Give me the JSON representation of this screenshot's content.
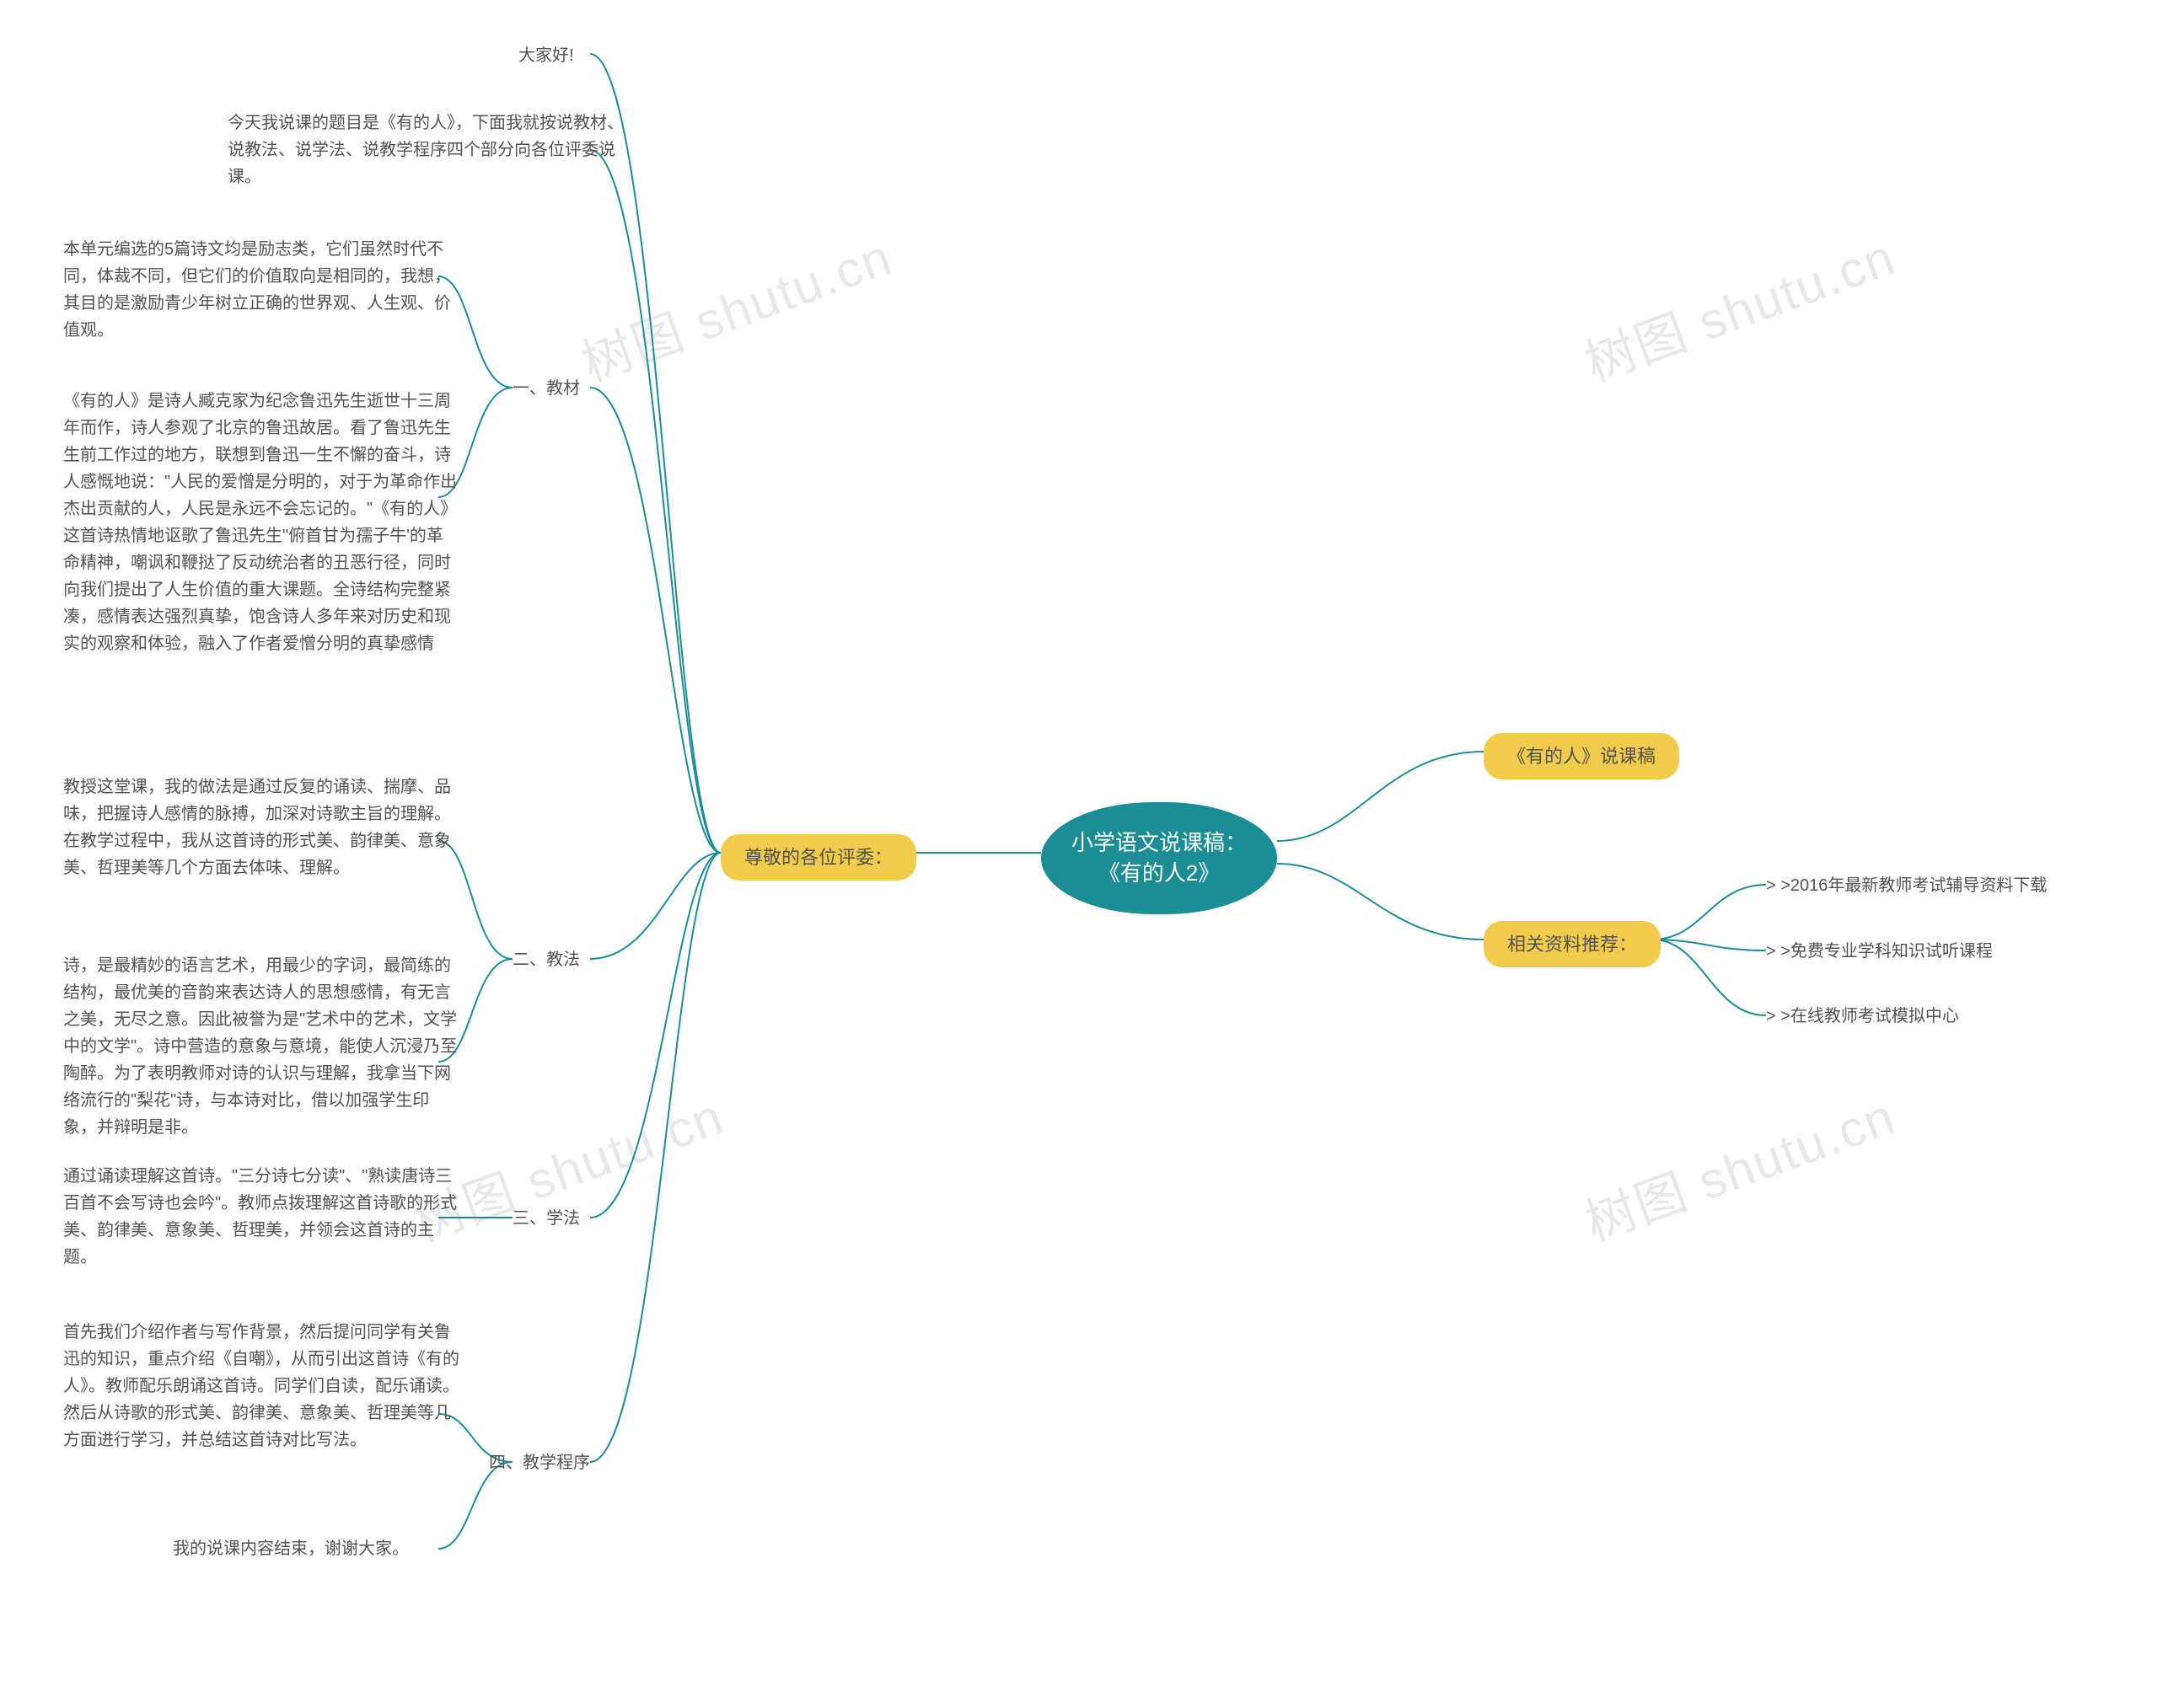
{
  "root": "小学语文说课稿：《有的人2》",
  "left": {
    "topic": "尊敬的各位评委：",
    "greet": "大家好!",
    "intro": "今天我说课的题目是《有的人》，下面我就按说教材、说教法、说学法、说教学程序四个部分向各位评委说课。",
    "sec1": {
      "title": "一、教材",
      "p1": "本单元编选的5篇诗文均是励志类，它们虽然时代不同，体裁不同，但它们的价值取向是相同的，我想，其目的是激励青少年树立正确的世界观、人生观、价值观。",
      "p2": "《有的人》是诗人臧克家为纪念鲁迅先生逝世十三周年而作，诗人参观了北京的鲁迅故居。看了鲁迅先生生前工作过的地方，联想到鲁迅一生不懈的奋斗，诗人感慨地说：\"人民的爱憎是分明的，对于为革命作出杰出贡献的人，人民是永远不会忘记的。\"《有的人》这首诗热情地讴歌了鲁迅先生\"俯首甘为孺子牛'的革命精神，嘲讽和鞭挞了反动统治者的丑恶行径，同时向我们提出了人生价值的重大课题。全诗结构完整紧凑，感情表达强烈真挚，饱含诗人多年来对历史和现实的观察和体验，融入了作者爱憎分明的真挚感情"
    },
    "sec2": {
      "title": "二、教法",
      "p1": "教授这堂课，我的做法是通过反复的诵读、揣摩、品味，把握诗人感情的脉搏，加深对诗歌主旨的理解。在教学过程中，我从这首诗的形式美、韵律美、意象美、哲理美等几个方面去体味、理解。",
      "p2": "诗，是最精妙的语言艺术，用最少的字词，最简练的结构，最优美的音韵来表达诗人的思想感情，有无言之美，无尽之意。因此被誉为是\"艺术中的艺术，文学中的文学\"。诗中营造的意象与意境，能使人沉浸乃至陶醉。为了表明教师对诗的认识与理解，我拿当下网络流行的\"梨花\"诗，与本诗对比，借以加强学生印象，并辩明是非。"
    },
    "sec3": {
      "title": "三、学法",
      "p1": "通过诵读理解这首诗。\"三分诗七分读\"、\"熟读唐诗三百首不会写诗也会吟\"。教师点拨理解这首诗歌的形式美、韵律美、意象美、哲理美，并领会这首诗的主题。"
    },
    "sec4": {
      "title": "四、教学程序",
      "p1": "首先我们介绍作者与写作背景，然后提问同学有关鲁迅的知识，重点介绍《自嘲》，从而引出这首诗《有的人》。教师配乐朗诵这首诗。同学们自读，配乐诵读。然后从诗歌的形式美、韵律美、意象美、哲理美等几方面进行学习，并总结这首诗对比写法。",
      "p2": "我的说课内容结束，谢谢大家。"
    }
  },
  "right": {
    "r1": "《有的人》说课稿",
    "r2": {
      "title": "相关资料推荐：",
      "items": [
        "> >2016年最新教师考试辅导资料下载",
        "> >免费专业学科知识试听课程",
        "> >在线教师考试模拟中心"
      ]
    }
  },
  "watermark": "树图 shutu.cn"
}
